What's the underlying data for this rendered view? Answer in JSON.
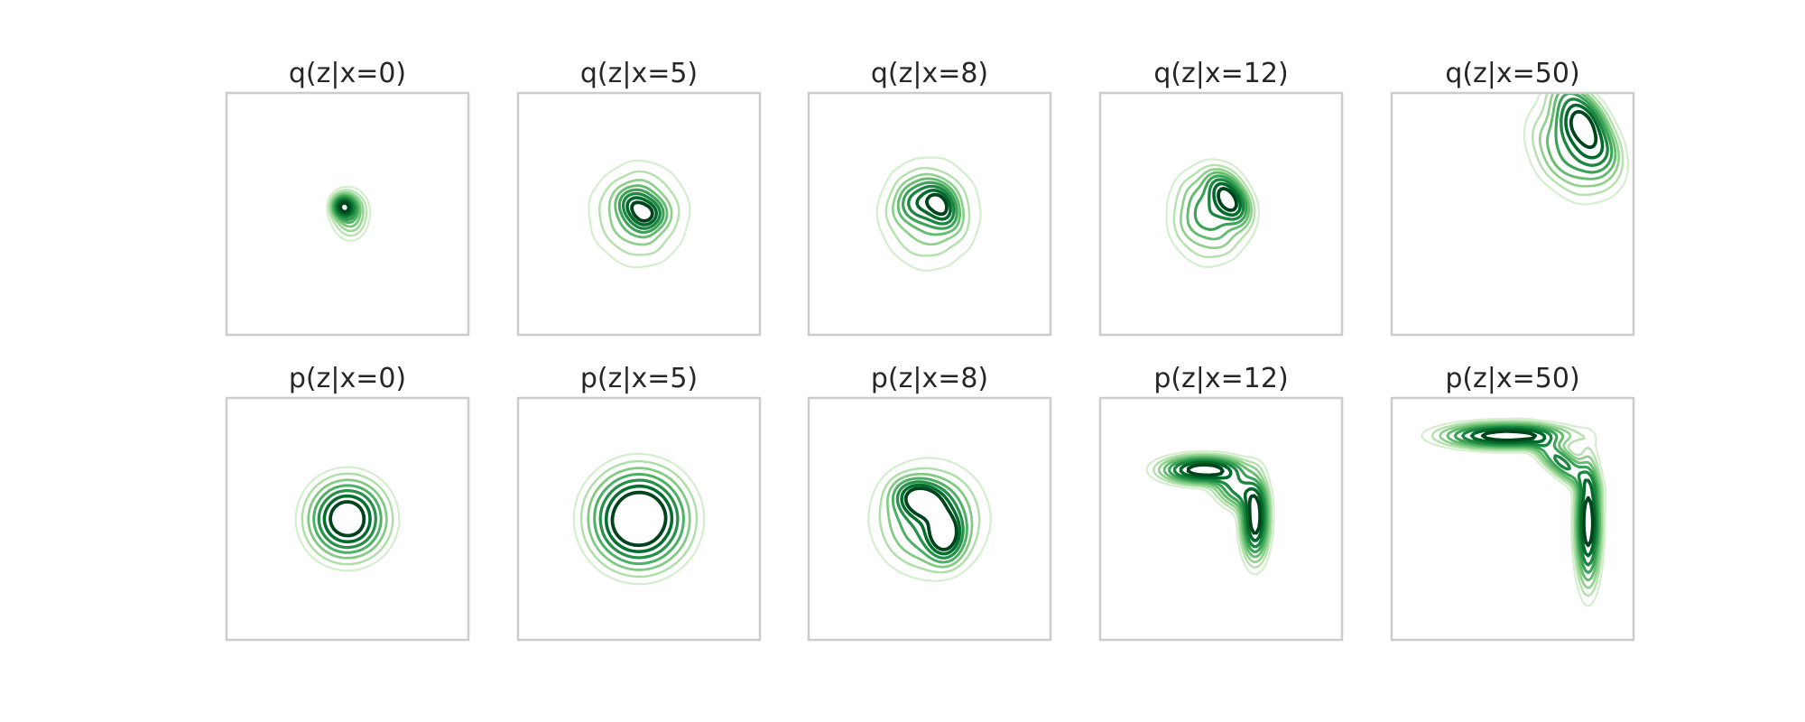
{
  "chart_data": {
    "type": "contour",
    "colormap": "Greens",
    "axes_visible": false,
    "grid": false,
    "frame_color": "#cccccc",
    "rows": [
      {
        "panels": [
          {
            "title": "q(z|x=0)",
            "modes": [
              [
                -0.05,
                0.1,
                0.09,
                0.09,
                0,
                1.0
              ],
              [
                0.03,
                0.0,
                0.15,
                0.2,
                0,
                0.5
              ]
            ],
            "levels": [
              0.07,
              0.12,
              0.18,
              0.25,
              0.33,
              0.42,
              0.55,
              0.7,
              0.85
            ],
            "wobble": 0.07
          },
          {
            "title": "q(z|x=5)",
            "modes": [
              [
                0.1,
                0.0,
                0.12,
                0.12,
                0,
                1.0
              ],
              [
                -0.05,
                0.12,
                0.12,
                0.12,
                0,
                0.8
              ],
              [
                0.0,
                0.0,
                0.36,
                0.38,
                0,
                0.45
              ]
            ],
            "levels": [
              0.05,
              0.1,
              0.16,
              0.23,
              0.32,
              0.44,
              0.6,
              0.78
            ],
            "wobble": 0.06
          },
          {
            "title": "q(z|x=8)",
            "modes": [
              [
                0.15,
                0.1,
                0.12,
                0.16,
                0.4,
                1.0
              ],
              [
                -0.1,
                0.15,
                0.2,
                0.18,
                0,
                0.6
              ],
              [
                0.0,
                0.0,
                0.38,
                0.42,
                0,
                0.4
              ]
            ],
            "levels": [
              0.05,
              0.1,
              0.16,
              0.23,
              0.32,
              0.44,
              0.6,
              0.78
            ],
            "wobble": 0.06
          },
          {
            "title": "q(z|x=12)",
            "modes": [
              [
                0.1,
                0.2,
                0.12,
                0.2,
                0.6,
                1.0
              ],
              [
                -0.15,
                0.0,
                0.3,
                0.36,
                0,
                0.5
              ]
            ],
            "levels": [
              0.06,
              0.11,
              0.17,
              0.24,
              0.33,
              0.45,
              0.6,
              0.78
            ],
            "wobble": 0.05
          },
          {
            "title": "q(z|x=50)",
            "modes": [
              [
                0.95,
                1.15,
                0.16,
                0.35,
                0.5,
                1.0
              ],
              [
                0.8,
                0.85,
                0.3,
                0.4,
                0.6,
                0.5
              ]
            ],
            "levels": [
              0.06,
              0.11,
              0.17,
              0.24,
              0.33,
              0.45,
              0.6,
              0.78
            ],
            "wobble": 0.04
          }
        ]
      },
      {
        "panels": [
          {
            "title": "p(z|x=0)",
            "modes": [
              [
                0.0,
                0.0,
                0.28,
                0.28,
                0,
                1.0
              ]
            ],
            "levels": [
              0.05,
              0.1,
              0.18,
              0.28,
              0.4,
              0.55,
              0.72
            ],
            "wobble": 0.01
          },
          {
            "title": "p(z|x=5)",
            "modes": [
              [
                0.0,
                0.0,
                0.34,
                0.34,
                0,
                1.0
              ]
            ],
            "levels": [
              0.04,
              0.08,
              0.14,
              0.22,
              0.32,
              0.44,
              0.58
            ],
            "wobble": 0.01
          },
          {
            "title": "p(z|x=8)",
            "modes": [
              [
                -0.1,
                0.25,
                0.2,
                0.14,
                -0.3,
                0.9
              ],
              [
                0.2,
                -0.2,
                0.14,
                0.2,
                0,
                0.9
              ],
              [
                0.0,
                0.0,
                0.4,
                0.4,
                0,
                0.5
              ]
            ],
            "levels": [
              0.05,
              0.1,
              0.16,
              0.24,
              0.34,
              0.46,
              0.6
            ],
            "wobble": 0.01
          },
          {
            "title": "p(z|x=12)",
            "modes": [
              [
                -0.25,
                0.65,
                0.3,
                0.1,
                0,
                1.0
              ],
              [
                0.45,
                0.0,
                0.1,
                0.3,
                0,
                1.0
              ],
              [
                0.2,
                0.4,
                0.2,
                0.14,
                -0.6,
                0.5
              ]
            ],
            "levels": [
              0.05,
              0.1,
              0.16,
              0.24,
              0.34,
              0.46,
              0.62,
              0.8
            ],
            "wobble": 0.01
          },
          {
            "title": "p(z|x=50)",
            "modes": [
              [
                -0.1,
                1.1,
                0.45,
                0.09,
                0,
                1.0
              ],
              [
                1.0,
                -0.05,
                0.09,
                0.45,
                0,
                1.0
              ],
              [
                0.65,
                0.75,
                0.3,
                0.1,
                -0.7,
                0.5
              ]
            ],
            "levels": [
              0.05,
              0.1,
              0.16,
              0.24,
              0.34,
              0.46,
              0.62,
              0.8
            ],
            "wobble": 0.01
          }
        ]
      }
    ]
  }
}
